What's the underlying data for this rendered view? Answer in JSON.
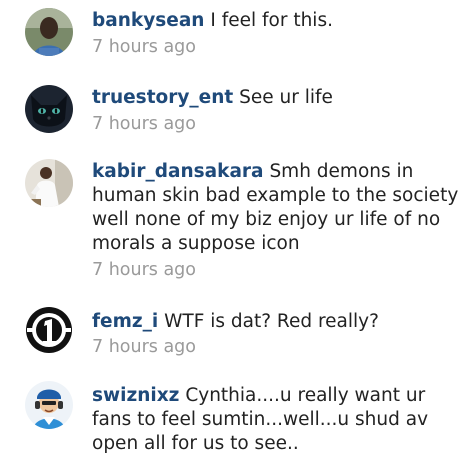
{
  "comments": [
    {
      "username": "bankysean",
      "text": "I feel for this.",
      "time": "7 hours ago",
      "avatar_icon": "person-photo"
    },
    {
      "username": "truestory_ent",
      "text": "See ur life",
      "time": "7 hours ago",
      "avatar_icon": "black-cat-photo"
    },
    {
      "username": "kabir_dansakara",
      "text": "Smh demons in human skin bad example to the society well none of my biz enjoy ur life of no morals a suppose icon",
      "time": "7 hours ago",
      "avatar_icon": "person-white-robe-photo"
    },
    {
      "username": "femz_i",
      "text": "WTF is dat? Red really?",
      "time": "7 hours ago",
      "avatar_icon": "number-one-logo"
    },
    {
      "username": "swiznixz",
      "text": "Cynthia....u really want ur fans to feel sumtin...well...u shud av open all for us to see..",
      "time": "",
      "avatar_icon": "cartoon-dj-avatar"
    }
  ],
  "colors": {
    "username": "#1f4a7a",
    "body_text": "#222222",
    "timestamp": "#9a9a9a"
  }
}
